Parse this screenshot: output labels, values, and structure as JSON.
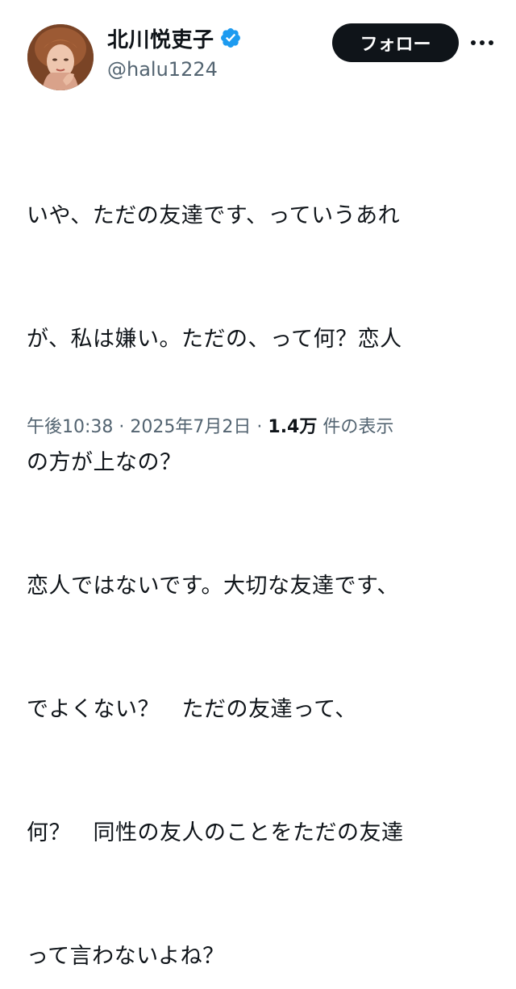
{
  "user": {
    "display_name": "北川悦吏子",
    "handle": "@halu1224",
    "avatar_icon": "profile-photo",
    "verified_icon": "verified-badge-icon",
    "verified_color": "#1d9bf0"
  },
  "actions": {
    "follow_label": "フォロー",
    "more_icon": "more-horizontal-icon"
  },
  "tweet": {
    "lines": [
      "いや、ただの友達です、っていうあれ",
      "が、私は嫌い。ただの、って何？恋人",
      "の方が上なの？",
      "恋人ではないです。大切な友達です、",
      "でよくない？　ただの友達って、",
      "何？　同性の友人のことをただの友達",
      "って言わないよね？"
    ]
  },
  "meta": {
    "time": "午後10:38",
    "separator": "·",
    "date": "2025年7月2日",
    "views_count": "1.4万",
    "views_label": "件の表示"
  },
  "colors": {
    "text": "#0f1419",
    "secondary_text": "#536471",
    "button_bg": "#0f1419",
    "button_text": "#ffffff"
  }
}
